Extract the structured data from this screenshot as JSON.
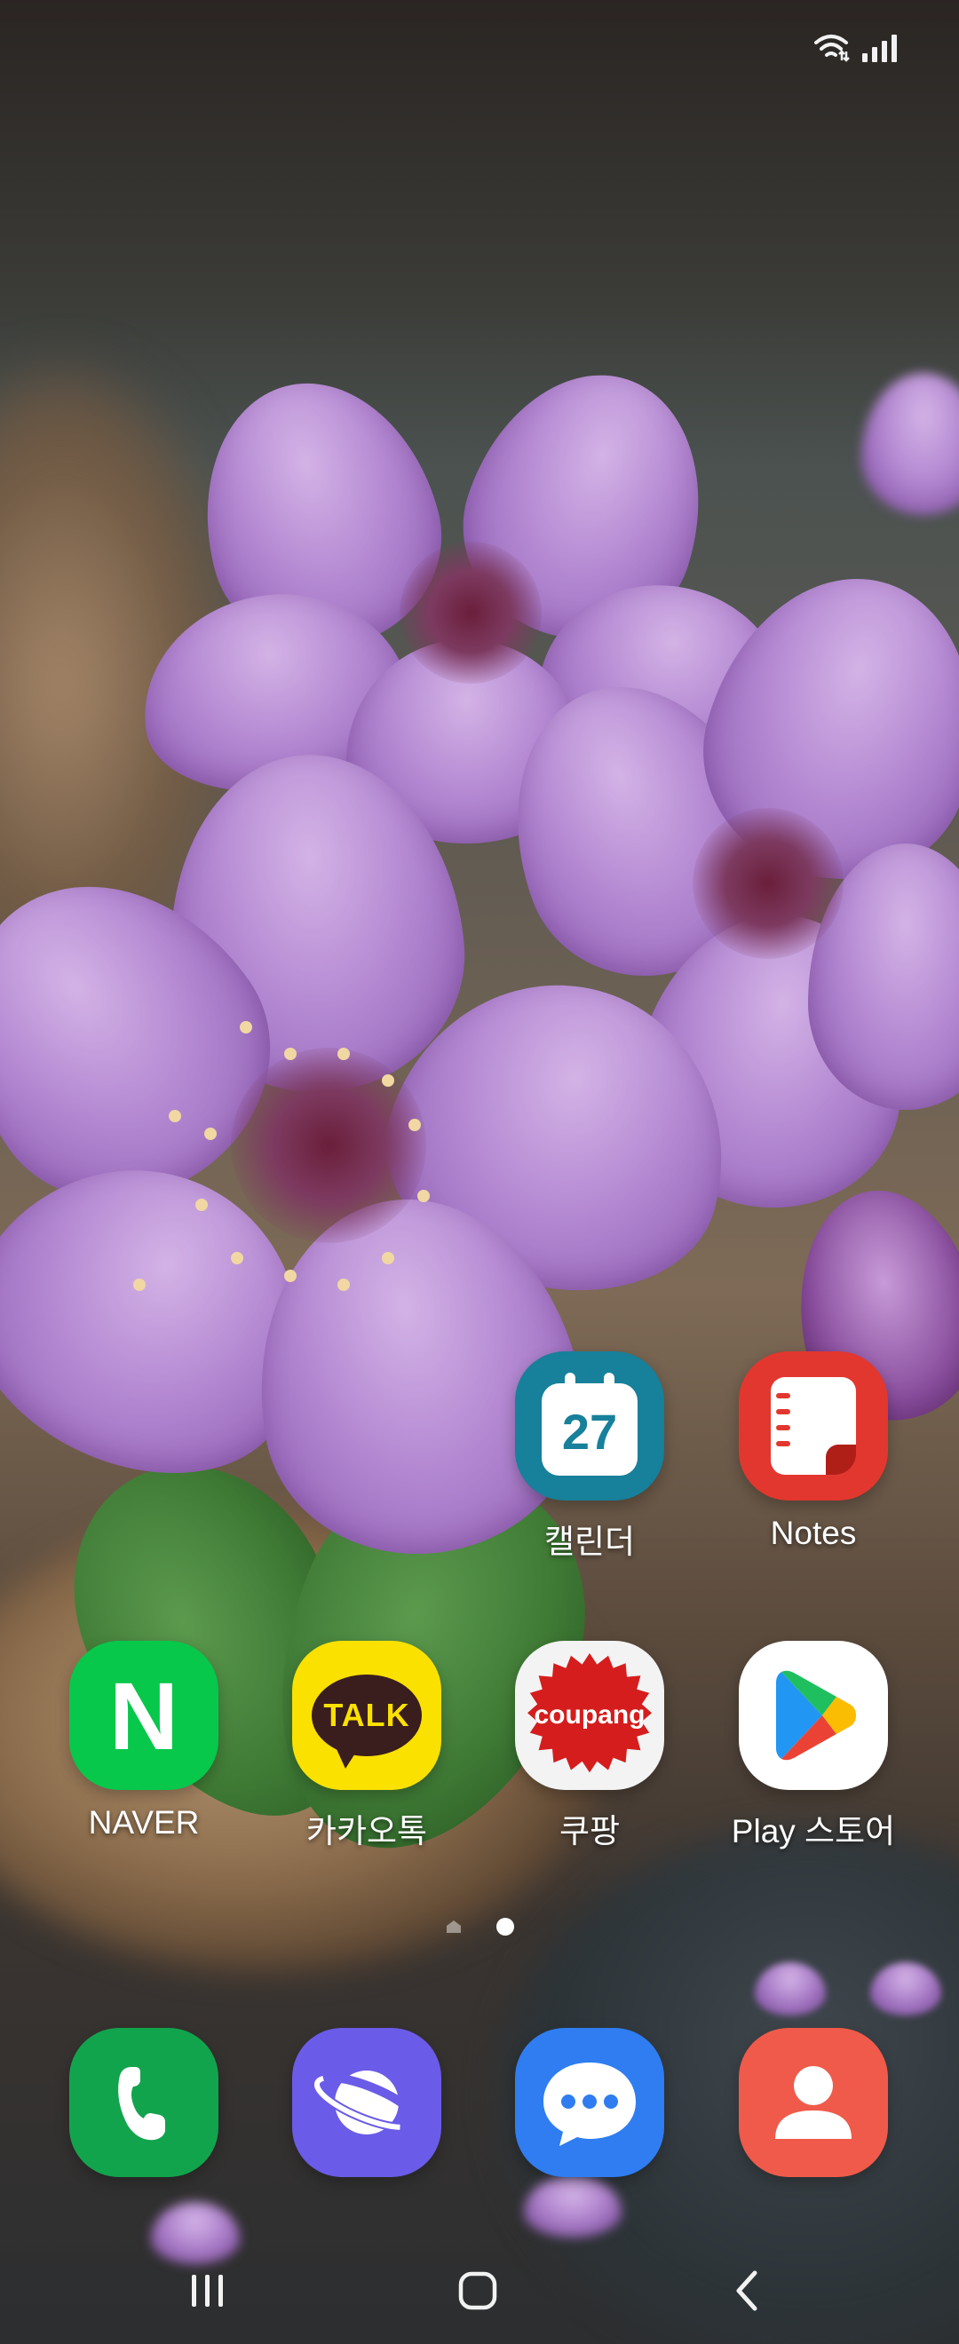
{
  "status_bar": {
    "icons": [
      "wifi-icon",
      "signal-icon"
    ]
  },
  "home": {
    "apps_row1": [
      {
        "name": "calendar",
        "label": "캘린더",
        "icon_text": "27",
        "color": "#17809a"
      },
      {
        "name": "notes",
        "label": "Notes",
        "color": "#e2372f"
      }
    ],
    "apps_row2": [
      {
        "name": "naver",
        "label": "NAVER",
        "icon_text": "N",
        "color": "#07c84b"
      },
      {
        "name": "kakaotalk",
        "label": "카카오톡",
        "icon_text": "TALK",
        "color": "#fae100"
      },
      {
        "name": "coupang",
        "label": "쿠팡",
        "icon_text": "coupang",
        "color": "#d51d1d"
      },
      {
        "name": "play-store",
        "label": "Play 스토어",
        "color": "#ffffff"
      }
    ],
    "page_indicator": {
      "pages": 2,
      "current": 2
    }
  },
  "dock": [
    {
      "name": "phone",
      "icon": "phone-icon",
      "color": "#12a44d"
    },
    {
      "name": "internet",
      "icon": "planet-icon",
      "color": "#6a5be8"
    },
    {
      "name": "messages",
      "icon": "chat-bubble-icon",
      "color": "#2f7df0"
    },
    {
      "name": "contacts",
      "icon": "person-icon",
      "color": "#f05a4a"
    }
  ],
  "nav_bar": [
    "recent-apps-icon",
    "home-icon",
    "back-icon"
  ]
}
